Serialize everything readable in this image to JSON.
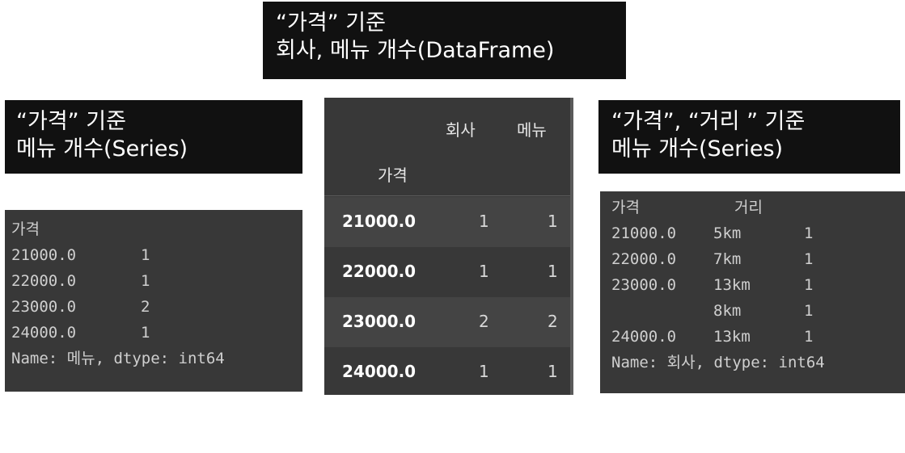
{
  "top_label": {
    "line1": "“가격” 기준",
    "line2": "회사, 메뉴 개수(DataFrame)"
  },
  "left_label": {
    "line1": "“가격” 기준",
    "line2": "메뉴 개수(Series)"
  },
  "right_label": {
    "line1": "“가격”, “거리 ”  기준",
    "line2": "메뉴 개수(Series)"
  },
  "left_series": {
    "index_name": "가격",
    "rows": [
      {
        "price": "21000.0",
        "count": "1"
      },
      {
        "price": "22000.0",
        "count": "1"
      },
      {
        "price": "23000.0",
        "count": "2"
      },
      {
        "price": "24000.0",
        "count": "1"
      }
    ],
    "footer": "Name: 메뉴, dtype: int64"
  },
  "dataframe": {
    "columns": [
      "회사",
      "메뉴"
    ],
    "index_name": "가격",
    "rows": [
      {
        "index": "21000.0",
        "company": "1",
        "menu": "1"
      },
      {
        "index": "22000.0",
        "company": "1",
        "menu": "1"
      },
      {
        "index": "23000.0",
        "company": "2",
        "menu": "2"
      },
      {
        "index": "24000.0",
        "company": "1",
        "menu": "1"
      }
    ]
  },
  "right_series": {
    "index_names": [
      "가격",
      "거리"
    ],
    "rows": [
      {
        "price": "21000.0",
        "distance": "5km",
        "count": "1"
      },
      {
        "price": "22000.0",
        "distance": "7km",
        "count": "1"
      },
      {
        "price": "23000.0",
        "distance": "13km",
        "count": "1"
      },
      {
        "price": "",
        "distance": "8km",
        "count": "1"
      },
      {
        "price": "24000.0",
        "distance": "13km",
        "count": "1"
      }
    ],
    "footer": "Name: 회사, dtype: int64"
  }
}
